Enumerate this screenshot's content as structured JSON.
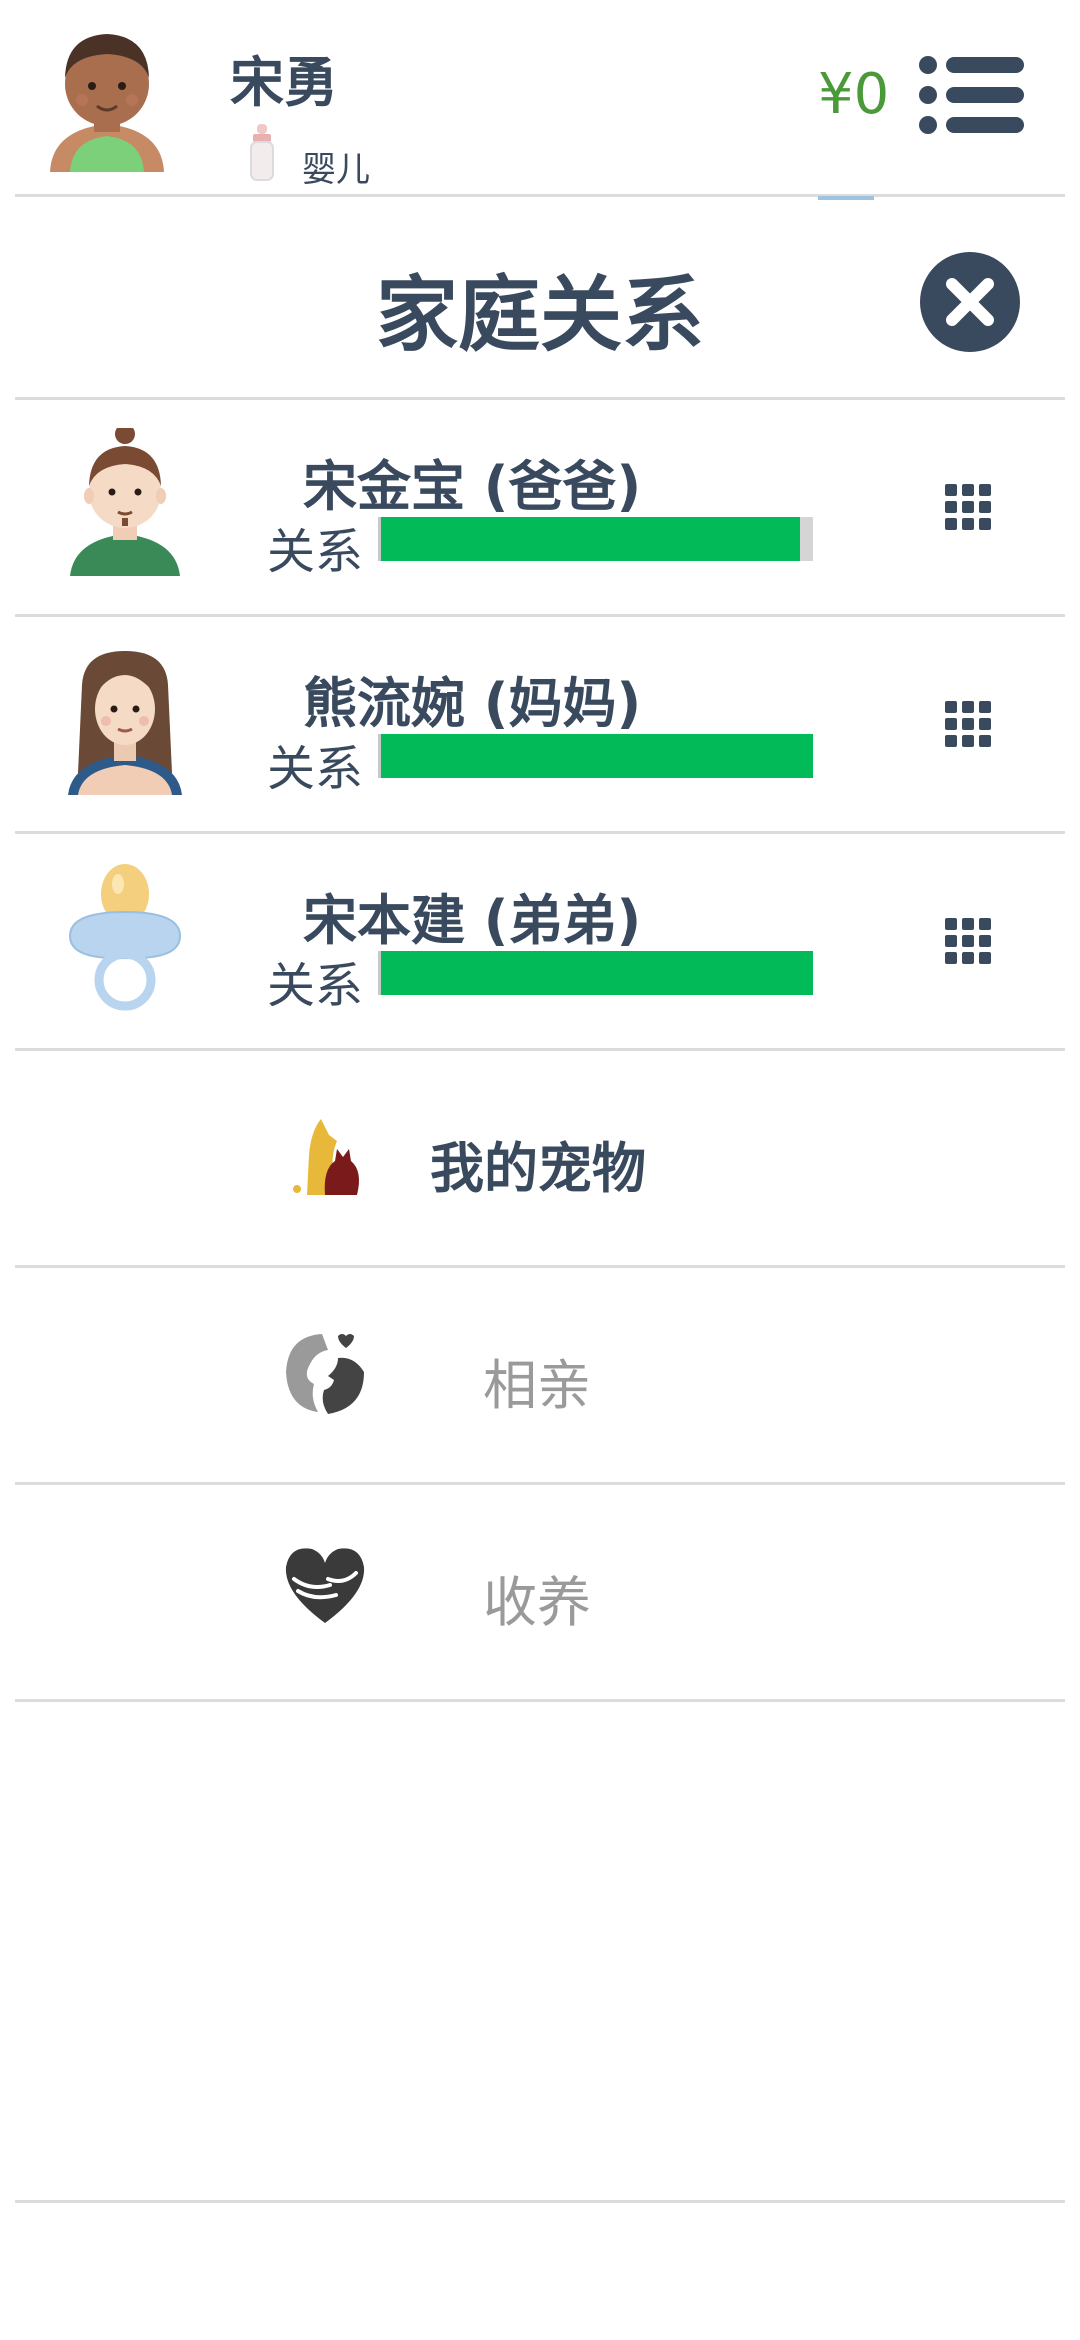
{
  "player": {
    "name": "宋勇",
    "life_stage": "婴儿",
    "money": "¥0"
  },
  "page": {
    "title": "家庭关系"
  },
  "relationship_label": "关系",
  "family": [
    {
      "name": "宋金宝 (爸爸)",
      "relationship_level": 0.97,
      "avatar": "father-avatar"
    },
    {
      "name": "熊流婉 (妈妈)",
      "relationship_level": 1.0,
      "avatar": "mother-avatar"
    },
    {
      "name": "宋本建 (弟弟)",
      "relationship_level": 1.0,
      "avatar": "pacifier-avatar"
    }
  ],
  "actions": [
    {
      "label": "我的宠物",
      "icon": "pet-icon",
      "enabled": true
    },
    {
      "label": "相亲",
      "icon": "couple-icon",
      "enabled": false
    },
    {
      "label": "收养",
      "icon": "heart-hands-icon",
      "enabled": false
    }
  ],
  "colors": {
    "primary_text": "#3a4a5e",
    "money": "#4a9a3a",
    "bar": "#02bb58",
    "disabled_text": "#9a9a9a"
  }
}
